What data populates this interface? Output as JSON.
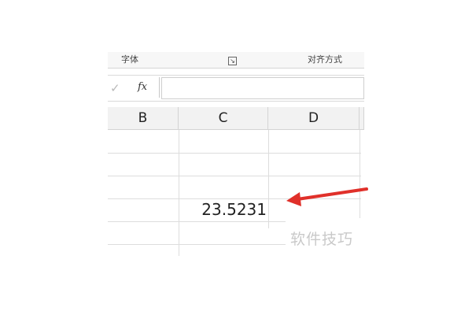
{
  "ribbon": {
    "font_group_label": "字体",
    "align_group_label": "对齐方式"
  },
  "formula_bar": {
    "fx_label": "fx",
    "value": ""
  },
  "columns": [
    "B",
    "C",
    "D"
  ],
  "cell_C": {
    "value": "23.5231"
  },
  "watermark": "软件技巧",
  "colors": {
    "arrow": "#e0302a",
    "gridline": "#dddddd",
    "header_bg": "#f2f2f2"
  }
}
